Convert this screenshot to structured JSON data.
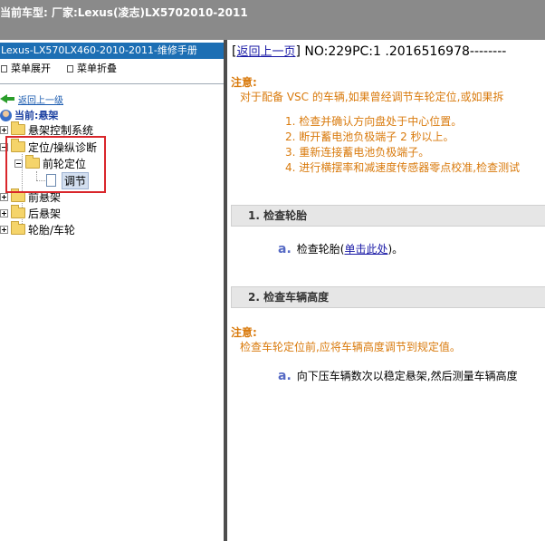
{
  "window": {
    "title": "当前车型: 厂家:Lexus(凌志)LX5702010-2011"
  },
  "sidebar": {
    "header": "Lexus-LX570LX460-2010-2011-维修手册",
    "expand_all": "菜单展开",
    "collapse_all": "菜单折叠",
    "back_up": "返回上一级",
    "current": "当前:悬架",
    "tree": {
      "suspension_control": "悬架控制系统",
      "alignment_diag": "定位/操纵诊断",
      "front_alignment": "前轮定位",
      "adjust": "调节",
      "front_suspension": "前悬架",
      "rear_suspension": "后悬架",
      "tire_wheel": "轮胎/车轮"
    }
  },
  "content": {
    "back_link": "返回上一页",
    "doc_no": "NO:229PC:1 .2016516978--------",
    "note1_title": "注意:",
    "note1_text": "对于配备 VSC 的车辆,如果曾经调节车轮定位,或如果拆",
    "steps": [
      "1. 检查并确认方向盘处于中心位置。",
      "2. 断开蓄电池负极端子 2 秒以上。",
      "3. 重新连接蓄电池负极端子。",
      "4. 进行横摆率和减速度传感器零点校准,检查测试"
    ],
    "section1": "1. 检查轮胎",
    "item_a_label": "a.",
    "item1_prefix": "检查轮胎(",
    "item1_link": "单击此处",
    "item1_suffix": ")。",
    "section2": "2. 检查车辆高度",
    "note2_title": "注意:",
    "note2_text": "检查车轮定位前,应将车辆高度调节到规定值。",
    "item2_text": "向下压车辆数次以稳定悬架,然后测量车辆高度"
  },
  "colors": {
    "accent_blue": "#1d6fb4",
    "note_orange": "#d97a0c",
    "highlight_red": "#d9262b"
  }
}
